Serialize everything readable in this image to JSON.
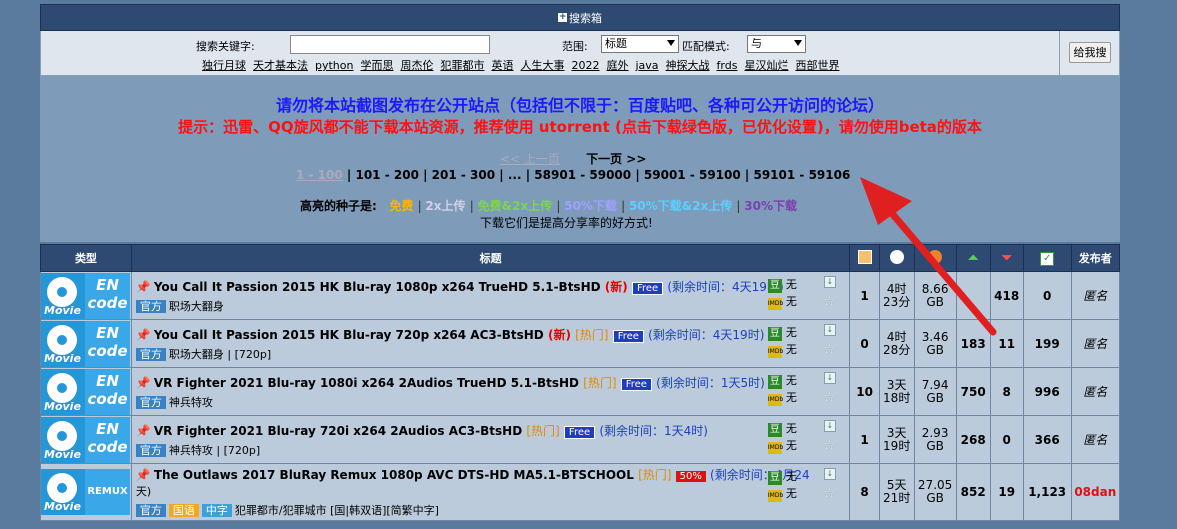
{
  "search": {
    "box_title": "搜索箱",
    "keyword_label": "搜索关键字:",
    "keyword_value": "",
    "scope_label": "范围:",
    "scope_value": "标题",
    "match_label": "匹配模式:",
    "match_value": "与",
    "submit_label": "给我搜",
    "hot_keywords": [
      "独行月球",
      "天才基本法",
      "python",
      "学而思",
      "周杰伦",
      "犯罪都市",
      "英语",
      "人生大事",
      "2022",
      "庭外",
      "java",
      "神探大战",
      "frds",
      "星汉灿烂",
      "西部世界"
    ]
  },
  "notice": {
    "line1": "请勿将本站截图发布在公开站点（包括但不限于：百度贴吧、各种可公开访问的论坛）",
    "line2": "提示：迅雷、QQ旋风都不能下载本站资源，推荐使用 utorrent (点击下载绿色版，已优化设置)，请勿使用beta的版本"
  },
  "pager": {
    "prev": "<< 上一页",
    "next": "下一页 >>",
    "current": "1 - 100",
    "pages": [
      "101 - 200",
      "201 - 300",
      "...",
      "58901 - 59000",
      "59001 - 59100",
      "59101 - 59106"
    ]
  },
  "legend": {
    "label": "高亮的种子是:",
    "free": "免费",
    "x2": "2x上传",
    "free2x": "免费&2x上传",
    "p50": "50%下载",
    "p502x": "50%下载&2x上传",
    "p30": "30%下载",
    "sub": "下载它们是提高分享率的好方式!"
  },
  "table": {
    "headers": {
      "type": "类型",
      "title": "标题",
      "uploader": "发布者"
    },
    "rows": [
      {
        "type_icon_text": "Movie",
        "type_code": [
          "EN",
          "code"
        ],
        "title": "You Call It Passion 2015 HK Blu-ray 1080p x264 TrueHD 5.1-BtsHD",
        "flag": "(新)",
        "hot": "",
        "promo": "Free",
        "remain": "(剩余时间：4天19时)",
        "tags": [
          "官方"
        ],
        "subtitle": "职场大翻身",
        "douban": "无",
        "imdb": "无",
        "comments": "1",
        "time": [
          "4时",
          "23分"
        ],
        "size": [
          "8.66",
          "GB"
        ],
        "seeders": "",
        "leechers": "418",
        "completed": "0",
        "uploader": "匿名"
      },
      {
        "type_icon_text": "Movie",
        "type_code": [
          "EN",
          "code"
        ],
        "title": "You Call It Passion 2015 HK Blu-ray 720p x264 AC3-BtsHD",
        "flag": "(新)",
        "hot": "[热门]",
        "promo": "Free",
        "remain": "(剩余时间：4天19时)",
        "tags": [
          "官方"
        ],
        "subtitle": "职场大翻身 | [720p]",
        "douban": "无",
        "imdb": "无",
        "comments": "0",
        "time": [
          "4时",
          "28分"
        ],
        "size": [
          "3.46",
          "GB"
        ],
        "seeders": "183",
        "leechers": "11",
        "completed": "199",
        "uploader": "匿名"
      },
      {
        "type_icon_text": "Movie",
        "type_code": [
          "EN",
          "code"
        ],
        "title": "VR Fighter 2021 Blu-ray 1080i x264 2Audios TrueHD 5.1-BtsHD",
        "flag": "",
        "hot": "[热门]",
        "promo": "Free",
        "remain": "(剩余时间：1天5时)",
        "tags": [
          "官方"
        ],
        "subtitle": "神兵特攻",
        "douban": "无",
        "imdb": "无",
        "comments": "10",
        "time": [
          "3天",
          "18时"
        ],
        "size": [
          "7.94",
          "GB"
        ],
        "seeders": "750",
        "leechers": "8",
        "completed": "996",
        "uploader": "匿名"
      },
      {
        "type_icon_text": "Movie",
        "type_code": [
          "EN",
          "code"
        ],
        "title": "VR Fighter 2021 Blu-ray 720i x264 2Audios AC3-BtsHD",
        "flag": "",
        "hot": "[热门]",
        "promo": "Free",
        "remain": "(剩余时间：1天4时)",
        "tags": [
          "官方"
        ],
        "subtitle": "神兵特攻 | [720p]",
        "douban": "无",
        "imdb": "无",
        "comments": "1",
        "time": [
          "3天",
          "19时"
        ],
        "size": [
          "2.93",
          "GB"
        ],
        "seeders": "268",
        "leechers": "0",
        "completed": "366",
        "uploader": "匿名"
      },
      {
        "type_icon_text": "Movie",
        "type_code": [
          "REMUX"
        ],
        "title": "The Outlaws 2017 BluRay Remux 1080p AVC DTS-HD MA5.1-BTSCHOOL",
        "title_wrap": "天)",
        "flag": "",
        "hot": "[热门]",
        "promo": "50%",
        "remain": "(剩余时间：4月24",
        "tags": [
          "官方",
          "国语",
          "中字"
        ],
        "subtitle": "犯罪都市/犯罪城市 [国|韩双语][简繁中字]",
        "douban": "无",
        "imdb": "无",
        "comments": "8",
        "time": [
          "5天",
          "21时"
        ],
        "size": [
          "27.05",
          "GB"
        ],
        "seeders": "852",
        "leechers": "19",
        "completed": "1,123",
        "uploader": "08dan"
      }
    ]
  },
  "colors": {
    "header_bg": "#2e4a72",
    "notice_blue": "#1a1aff",
    "notice_red": "#ff1111",
    "annotation_arrow": "#e02020"
  }
}
